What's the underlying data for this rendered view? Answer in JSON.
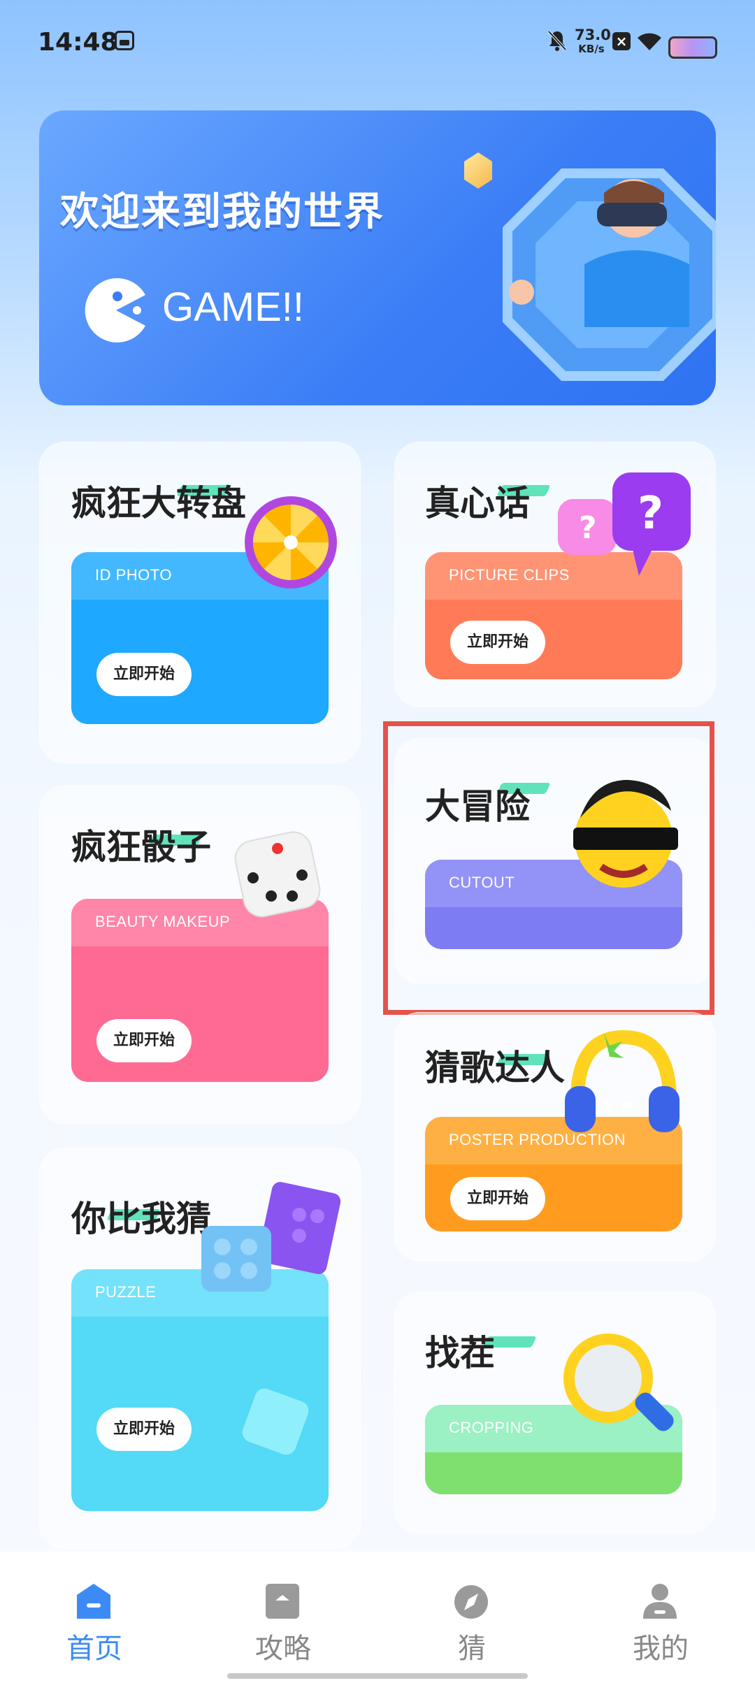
{
  "status_bar": {
    "time": "14:48",
    "net_speed_value": "73.0",
    "net_speed_unit": "KB/s",
    "icons": [
      "gallery-icon",
      "mute-icon",
      "close-icon",
      "wifi-icon",
      "battery-icon"
    ]
  },
  "banner": {
    "title": "欢迎来到我的世界",
    "subtitle": "GAME!!"
  },
  "cards": [
    {
      "title": "疯狂大转盘",
      "label": "ID PHOTO",
      "button": "立即开始",
      "color": "#1ea8ff"
    },
    {
      "title": "真心话",
      "label": "PICTURE CLIPS",
      "button": "立即开始",
      "color": "#ff7b57"
    },
    {
      "title": "疯狂骰子",
      "label": "BEAUTY MAKEUP",
      "button": "立即开始",
      "color": "#ff6a93"
    },
    {
      "title": "大冒险",
      "label": "CUTOUT",
      "color": "#7d7cf3"
    },
    {
      "title": "猜歌达人",
      "label": "POSTER PRODUCTION",
      "button": "立即开始",
      "color": "#ff9c1f"
    },
    {
      "title": "你比我猜",
      "label": "PUZZLE",
      "button": "立即开始",
      "color": "#54d9f7"
    },
    {
      "title": "找茬",
      "label": "CROPPING",
      "color": "#7fe070"
    }
  ],
  "nav": {
    "items": [
      {
        "label": "首页",
        "icon": "home-icon",
        "active": true
      },
      {
        "label": "攻略",
        "icon": "book-icon",
        "active": false
      },
      {
        "label": "猜",
        "icon": "compass-icon",
        "active": false
      },
      {
        "label": "我的",
        "icon": "user-icon",
        "active": false
      }
    ],
    "active_color": "#3c8bf5",
    "inactive_color": "#8a8a8a"
  }
}
